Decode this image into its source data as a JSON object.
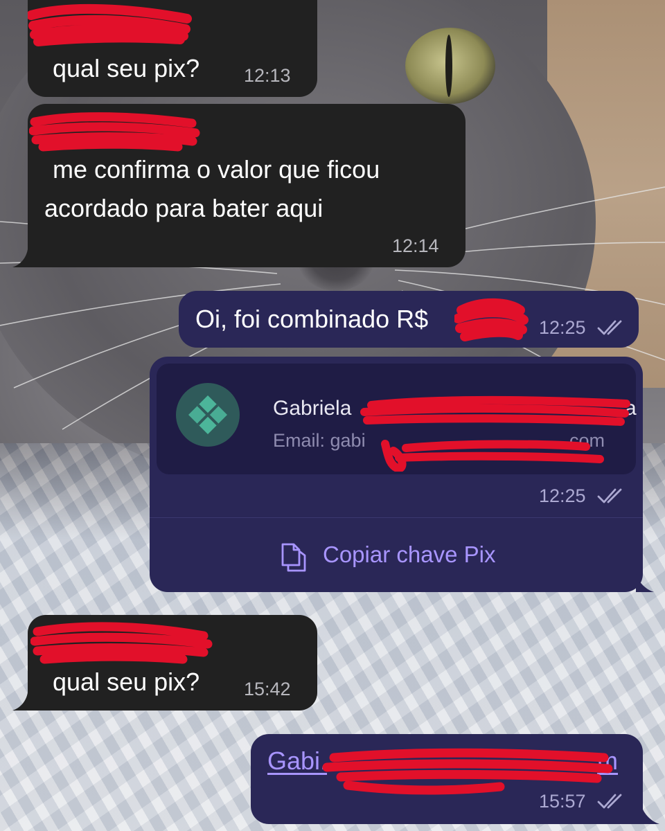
{
  "chat": {
    "messages": [
      {
        "direction": "incoming",
        "sender_redacted": true,
        "text": "qual seu pix?",
        "time": "12:13"
      },
      {
        "direction": "incoming",
        "sender_redacted": true,
        "text_line1": "me confirma o valor que ficou",
        "text_line2": "acordado para bater aqui",
        "time": "12:14"
      },
      {
        "direction": "outgoing",
        "text": "Oi, foi combinado R$",
        "time": "12:25",
        "status": "read"
      },
      {
        "direction": "outgoing",
        "type": "pix-key-card",
        "card": {
          "name": "Gabriela",
          "name_tail": "a",
          "email": "Email: gabi",
          "email_tail": "com"
        },
        "time": "12:25",
        "status": "read",
        "action_label": "Copiar chave Pix"
      },
      {
        "direction": "incoming",
        "sender_redacted": true,
        "text": "qual seu pix?",
        "time": "15:42"
      },
      {
        "direction": "outgoing",
        "text": "Gabi.",
        "text_tail": "m",
        "time": "15:57",
        "status": "read"
      }
    ]
  },
  "icons": {
    "read_ticks": "double-check-icon",
    "pix_logo": "pix-logo-icon",
    "copy": "copy-document-icon"
  },
  "colors": {
    "incoming_bubble": "#212121",
    "outgoing_bubble": "#2a2757",
    "card_bg": "#1f1c45",
    "accent": "#a895ff",
    "pix_green": "#4cb59a",
    "redaction": "#e2102a"
  }
}
